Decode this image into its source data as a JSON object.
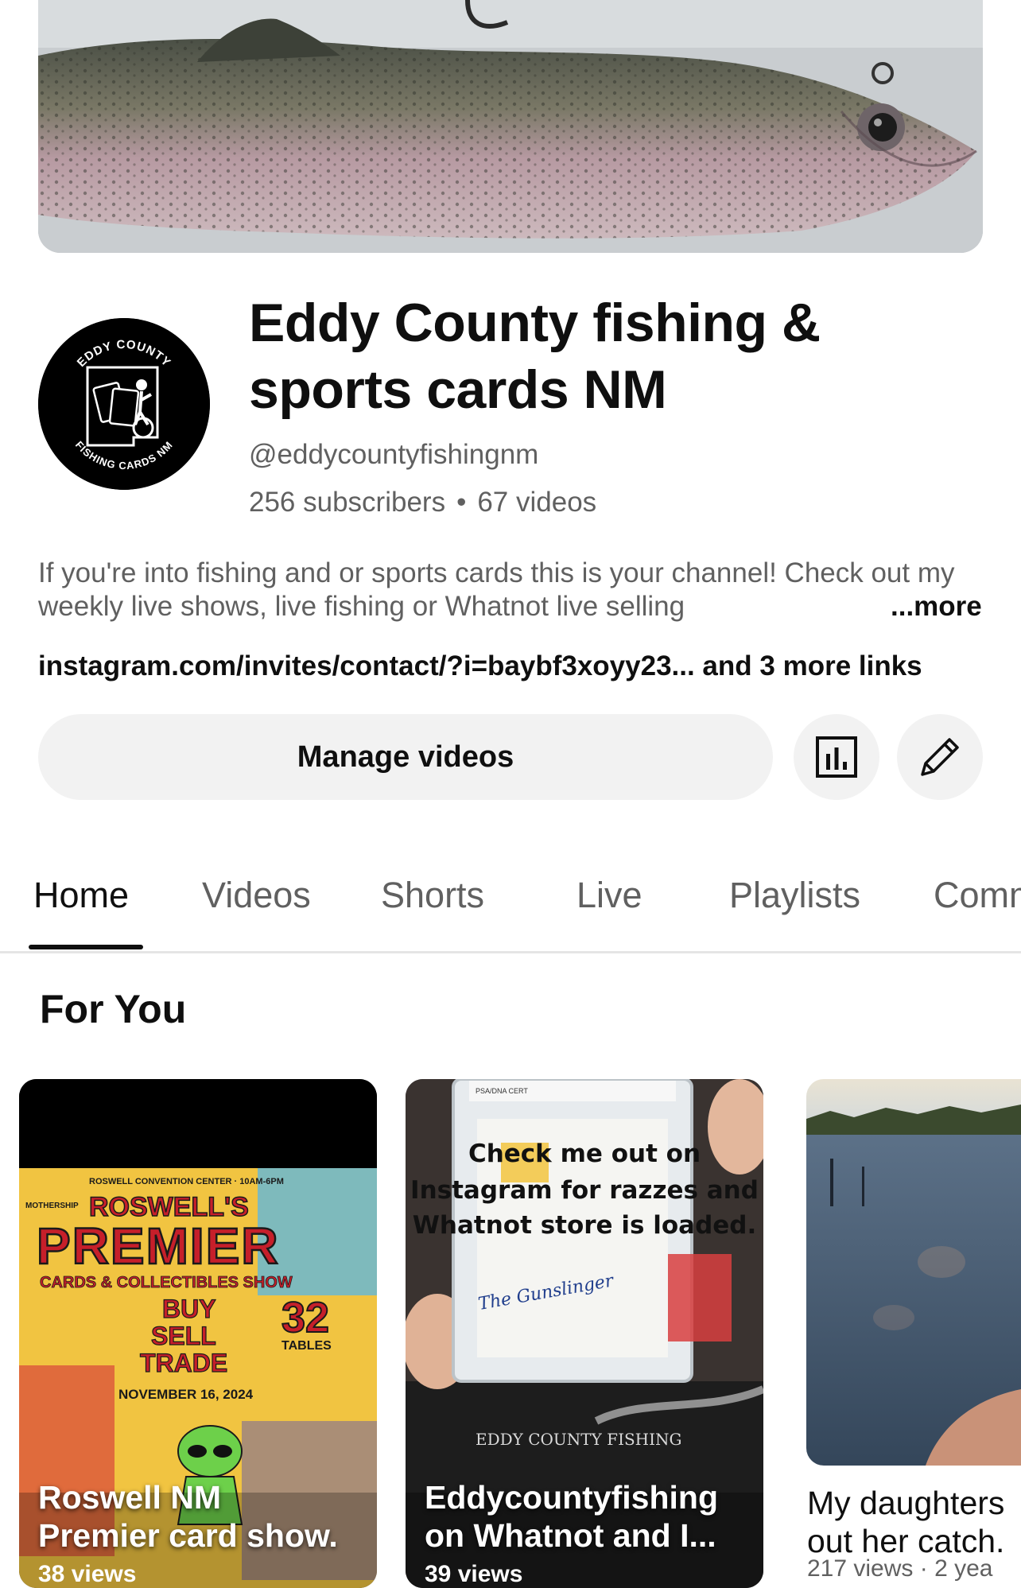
{
  "channel": {
    "name": "Eddy County fishing & sports cards NM",
    "handle": "@eddycountyfishingnm",
    "subscribers": "256 subscribers",
    "videos": "67 videos",
    "separator": "•",
    "description": "If you're into fishing and or sports cards this is your channel! Check out my weekly live shows, live fishing or Whatnot live selling",
    "more_label": "...more",
    "links": "instagram.com/invites/contact/?i=baybf3xoyy23... and 3 more links",
    "logo_text_top": "EDDY COUNTY",
    "logo_text_bottom": "FISHING CARDS NM"
  },
  "actions": {
    "manage_videos": "Manage videos",
    "analytics_icon": "bar-chart-icon",
    "edit_icon": "pencil-icon"
  },
  "tabs": [
    {
      "label": "Home",
      "active": true
    },
    {
      "label": "Videos",
      "active": false
    },
    {
      "label": "Shorts",
      "active": false
    },
    {
      "label": "Live",
      "active": false
    },
    {
      "label": "Playlists",
      "active": false
    },
    {
      "label": "Comm",
      "active": false
    }
  ],
  "section": {
    "title": "For You"
  },
  "cards": [
    {
      "title_line1": "Roswell NM",
      "title_line2": "Premier card show.",
      "views": "38 views",
      "poster": {
        "top": "ROSWELL CONVENTION CENTER · 10AM-6PM",
        "brand": "MOTHERSHIP",
        "line1": "ROSWELL'S",
        "line2": "PREMIER",
        "line3": "CARDS & COLLECTIBLES SHOW",
        "buy": "BUY",
        "sell": "SELL",
        "trade": "TRADE",
        "tables_num": "32",
        "tables": "TABLES",
        "date": "NOVEMBER 16, 2024"
      }
    },
    {
      "title_line1": "Eddycountyfishing",
      "title_line2": "on Whatnot and I...",
      "views": "39 views",
      "overlay_line1": "Check me out on",
      "overlay_line2": "Instagram for razzes and",
      "overlay_line3": "Whatnot store is loaded.",
      "slab_label": "PSA/DNA CERT",
      "signature": "The Gunslinger",
      "watermark": "EDDY COUNTY FISHING"
    },
    {
      "title_line1": "My daughters",
      "title_line2": "out her catch.",
      "meta": "217 views · 2 yea"
    }
  ]
}
